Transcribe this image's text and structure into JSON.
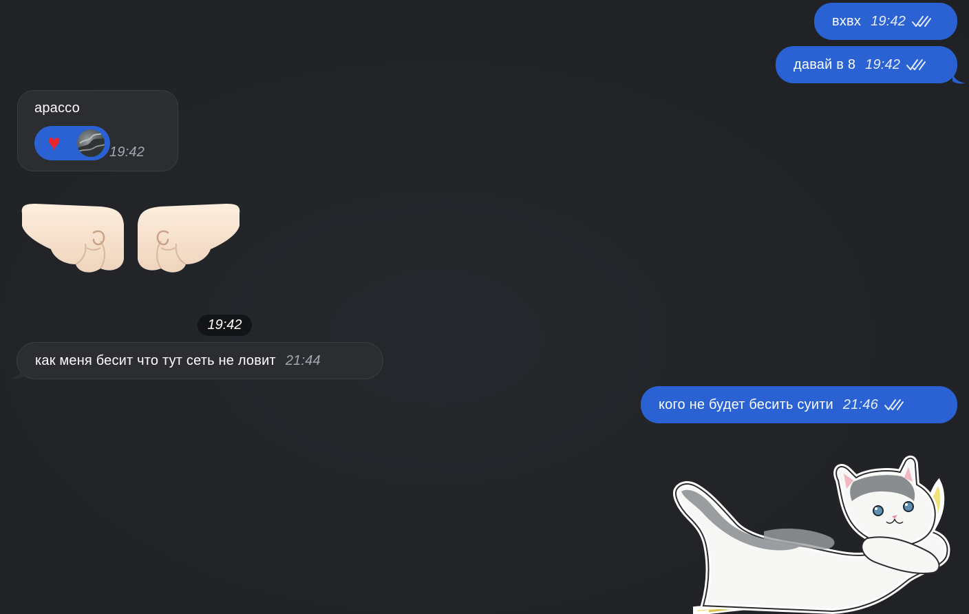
{
  "messages": {
    "m1": {
      "text": "вхвх",
      "time": "19:42"
    },
    "m2": {
      "text": "давай в 8",
      "time": "19:42"
    },
    "m3": {
      "text": "арассо",
      "time": "19:42",
      "reaction_emoji": "♥"
    },
    "m4": {
      "time": "19:42"
    },
    "m5": {
      "text": "как меня бесит что тут сеть не ловит",
      "time": "21:44"
    },
    "m6": {
      "text": "кого не будет бесить суити",
      "time": "21:46"
    }
  },
  "colors": {
    "background": "#212327",
    "outgoing_bubble": "#2a62d4",
    "incoming_bubble": "#2b2d31"
  }
}
